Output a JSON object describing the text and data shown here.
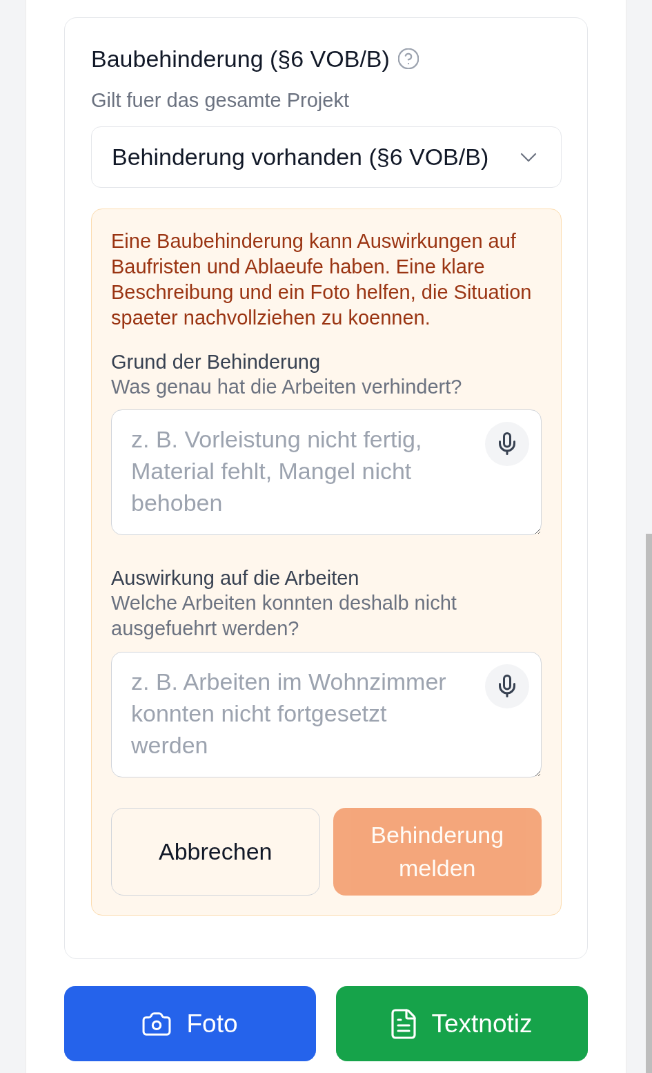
{
  "card": {
    "title": "Baubehinderung (§6 VOB/B)",
    "subtitle": "Gilt fuer das gesamte Projekt",
    "select": {
      "value": "Behinderung vorhanden (§6 VOB/B)"
    },
    "notice": {
      "text": "Eine Baubehinderung kann Auswirkungen auf Baufristen und Ablaeufe haben. Eine klare Beschreibung und ein Foto helfen, die Situation spaeter nachvollziehen zu koennen.",
      "fields": [
        {
          "label": "Grund der Behinderung",
          "hint": "Was genau hat die Arbeiten verhindert?",
          "placeholder": "z. B. Vorleistung nicht fertig, Material fehlt, Mangel nicht behoben"
        },
        {
          "label": "Auswirkung auf die Arbeiten",
          "hint": "Welche Arbeiten konnten deshalb nicht ausgefuehrt werden?",
          "placeholder": "z. B. Arbeiten im Wohnzimmer konnten nicht fortgesetzt werden"
        }
      ],
      "buttons": [
        {
          "label": "Abbrechen",
          "kind": "secondary",
          "disabled": false
        },
        {
          "label": "Behinderung melden",
          "kind": "primary",
          "disabled": true
        }
      ]
    }
  },
  "actions": [
    {
      "label": "Foto",
      "kind": "photo"
    },
    {
      "label": "Textnotiz",
      "kind": "note"
    }
  ]
}
